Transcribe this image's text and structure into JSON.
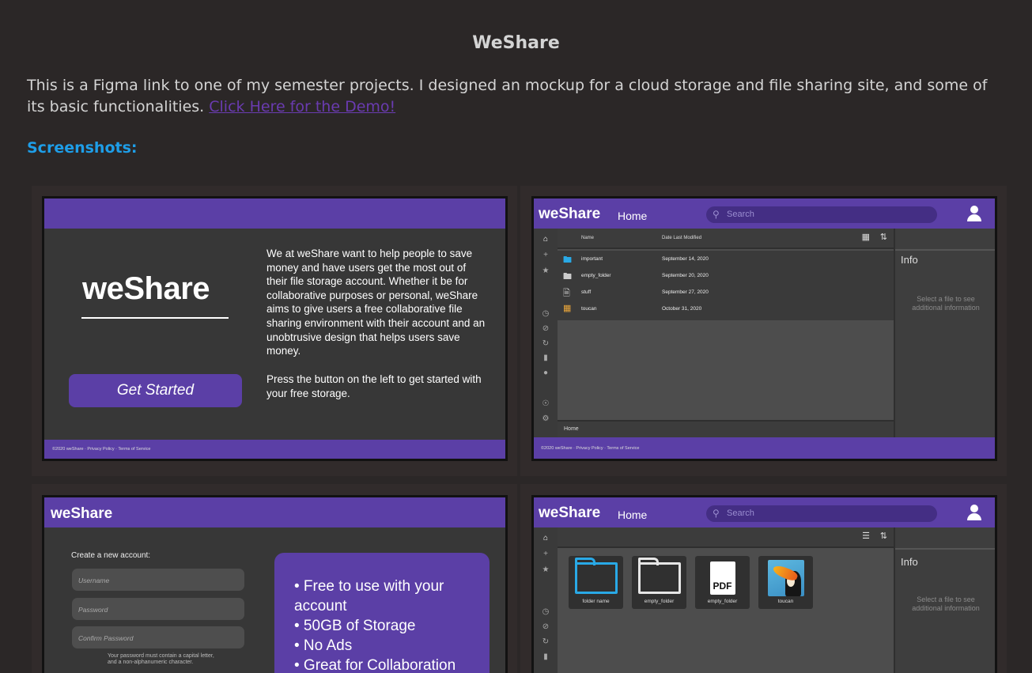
{
  "page": {
    "title": "WeShare",
    "intro_text": "This is a Figma link to one of my semester projects. I designed an mockup for a cloud storage and file sharing site, and some of its basic functionalities.",
    "demo_link": "Click Here for the Demo!",
    "screenshots_heading": "Screenshots:"
  },
  "shot_landing": {
    "logo": "weShare",
    "description": "We at weShare want to help people to save money and have users get the most out of their file storage account. Whether it be for collaborative purposes or personal, weShare aims to give users a free collaborative file sharing environment with their account and an unobtrusive design that helps users save money.",
    "description2": "Press the button on the left to get started with your free storage.",
    "button": "Get Started",
    "footer": "©2020 weShare  ·  Privacy Policy  ·  Terms of Service"
  },
  "shot_list": {
    "logo": "weShare",
    "nav": "Home",
    "search_placeholder": "Search",
    "col_name": "Name",
    "col_date": "Date Last Modified",
    "files": [
      {
        "name": "important",
        "date": "September 14, 2020",
        "icon": "folder-blue"
      },
      {
        "name": "empty_folder",
        "date": "September 20, 2020",
        "icon": "folder"
      },
      {
        "name": "stuff",
        "date": "September 27, 2020",
        "icon": "pdf"
      },
      {
        "name": "toucan",
        "date": "October 31, 2020",
        "icon": "image"
      }
    ],
    "info_title": "Info",
    "info_msg": "Select a file to see additional information",
    "path": "Home",
    "footer": "©2020 weShare  ·  Privacy Policy  ·  Terms of Service"
  },
  "shot_signup": {
    "logo": "weShare",
    "create_title": "Create a new account:",
    "username_placeholder": "Username",
    "password_placeholder": "Password",
    "confirm_placeholder": "Confirm Password",
    "password_note": "Your password must contain a capital letter, and a non-alphanumeric character.",
    "features": [
      "• Free to use with your account",
      "• 50GB of Storage",
      "• No Ads",
      "• Great for Collaboration"
    ]
  },
  "shot_grid": {
    "logo": "weShare",
    "nav": "Home",
    "search_placeholder": "Search",
    "tiles": [
      {
        "label": "folder name",
        "icon": "folder-blue"
      },
      {
        "label": "empty_folder",
        "icon": "folder"
      },
      {
        "label": "empty_folder",
        "icon": "pdf"
      },
      {
        "label": "toucan",
        "icon": "image"
      }
    ],
    "pdf_text": "PDF",
    "info_title": "Info",
    "info_msg": "Select a file to see additional information"
  },
  "colors": {
    "brand_purple": "#5b3fa6",
    "heading_blue": "#1e9ee8",
    "link_purple": "#6a3bb0",
    "folder_blue": "#29a9e6"
  }
}
